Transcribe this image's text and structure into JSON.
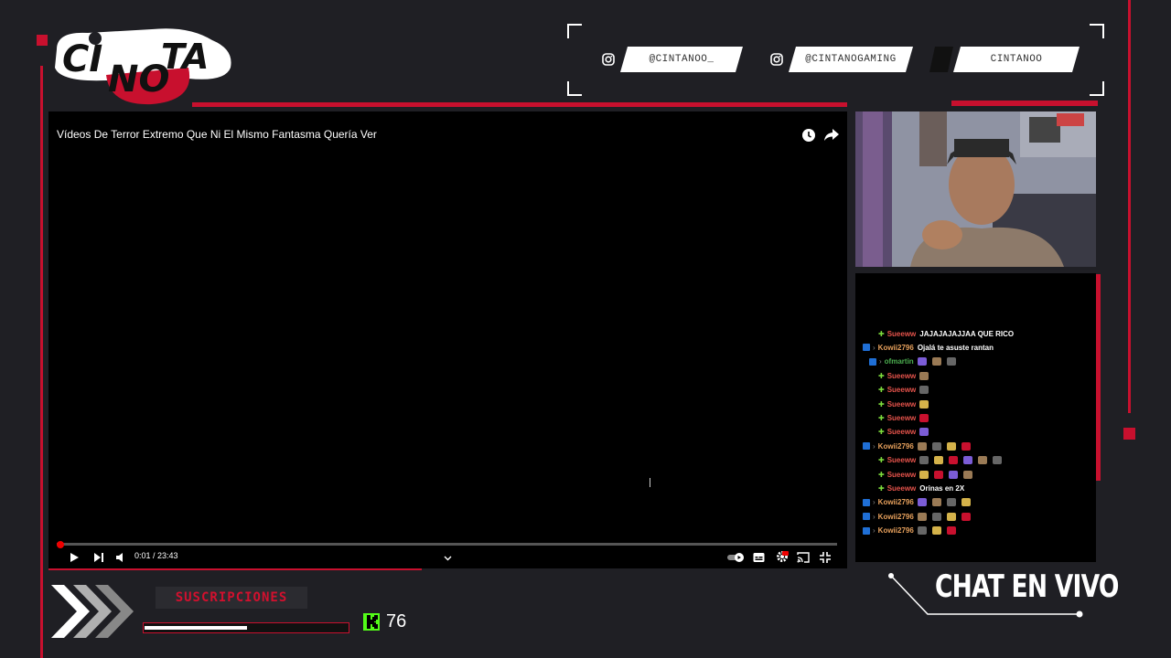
{
  "logo": {
    "line1": "CI",
    "line2": "TA",
    "overlay": "NO"
  },
  "socials": [
    {
      "icon": "instagram-icon",
      "handle": "@CINTANOO_"
    },
    {
      "icon": "instagram-icon",
      "handle": "@CINTANOGAMING"
    },
    {
      "icon": "generic-social-icon",
      "handle": "CINTANOO"
    }
  ],
  "player": {
    "title": "Vídeos De Terror Extremo Que Ni El Mismo Fantasma Quería Ver",
    "time": "0:01 / 23:43",
    "progress": 0.001
  },
  "chat": {
    "messages": [
      {
        "user": "Sueeww",
        "color": "#e5534b",
        "badge": "plus",
        "text": "JAJAJAJAJJAA QUE RICO",
        "emotes": 0
      },
      {
        "user": "Kowii2796",
        "color": "#e6a05c",
        "badge": "prime",
        "text": "Ojalá te asuste rantan",
        "emotes": 0
      },
      {
        "user": "ofmartin",
        "color": "#4caf50",
        "badge": "prime2",
        "text": "",
        "emotes": 3
      },
      {
        "user": "Sueeww",
        "color": "#e5534b",
        "badge": "plus",
        "text": "",
        "emotes": 1
      },
      {
        "user": "Sueeww",
        "color": "#e5534b",
        "badge": "plus",
        "text": "",
        "emotes": 1
      },
      {
        "user": "Sueeww",
        "color": "#e5534b",
        "badge": "plus",
        "text": "",
        "emotes": 1
      },
      {
        "user": "Sueeww",
        "color": "#e5534b",
        "badge": "plus",
        "text": "",
        "emotes": 1
      },
      {
        "user": "Sueeww",
        "color": "#e5534b",
        "badge": "plus",
        "text": "",
        "emotes": 1
      },
      {
        "user": "Kowii2796",
        "color": "#e6a05c",
        "badge": "prime",
        "text": "",
        "emotes": 4
      },
      {
        "user": "Sueeww",
        "color": "#e5534b",
        "badge": "plus",
        "text": "",
        "emotes": 6
      },
      {
        "user": "Sueeww",
        "color": "#e5534b",
        "badge": "plus",
        "text": "",
        "emotes": 4
      },
      {
        "user": "Sueeww",
        "color": "#e5534b",
        "badge": "plus",
        "text": "Orinas en 2X",
        "emotes": 0
      },
      {
        "user": "Kowii2796",
        "color": "#e6a05c",
        "badge": "prime",
        "text": "",
        "emotes": 4
      },
      {
        "user": "Kowii2796",
        "color": "#e6a05c",
        "badge": "prime",
        "text": "",
        "emotes": 4
      },
      {
        "user": "Kowii2796",
        "color": "#e6a05c",
        "badge": "prime",
        "text": "",
        "emotes": 3
      }
    ]
  },
  "subs": {
    "label": "SUSCRIPCIONES",
    "progress": 0.5
  },
  "kick": {
    "count": "76"
  },
  "chat_live": "CHAT EN VIVO",
  "colors": {
    "accent": "#c8102e",
    "background": "#1f1f24",
    "kick": "#53fc18"
  }
}
